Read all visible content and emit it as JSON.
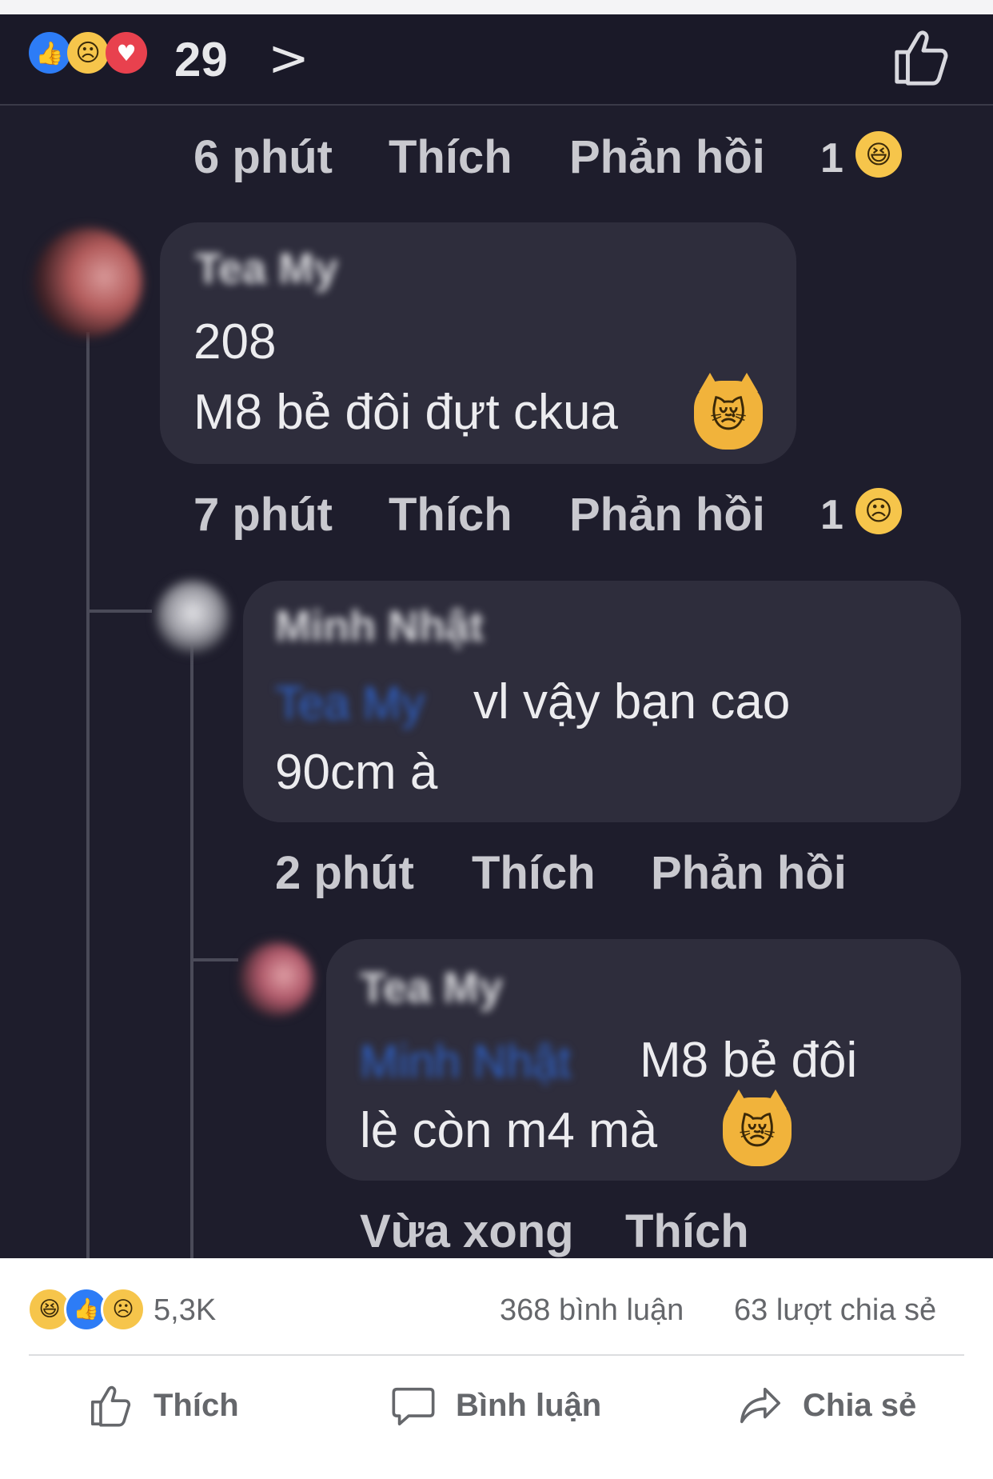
{
  "reactions_top": {
    "count": "29",
    "chevron": ">"
  },
  "comment1_meta": {
    "time": "6 phút",
    "like": "Thích",
    "reply": "Phản hồi",
    "reaction_count": "1"
  },
  "comment2": {
    "author": "Tea My",
    "line1": "208",
    "line2": "M8 bẻ đôi đựt ckua",
    "meta": {
      "time": "7 phút",
      "like": "Thích",
      "reply": "Phản hồi",
      "reaction_count": "1"
    }
  },
  "comment3": {
    "author": "Minh Nhật",
    "mention": "Tea My",
    "line1": "vl vậy bạn cao",
    "line2": "90cm à",
    "meta": {
      "time": "2 phút",
      "like": "Thích",
      "reply": "Phản hồi"
    }
  },
  "comment4": {
    "author": "Tea My",
    "mention": "Minh Nhật",
    "line1": "M8 bẻ đôi",
    "line2": "lè còn m4 mà",
    "meta": {
      "time": "Vừa xong",
      "like": "Thích"
    }
  },
  "post_summary": {
    "reaction_count": "5,3K",
    "comments": "368 bình luận",
    "shares": "63 lượt chia sẻ"
  },
  "actions": {
    "like": "Thích",
    "comment": "Bình luận",
    "share": "Chia sẻ"
  },
  "colors": {
    "dark_bg": "#1e1d2c",
    "bubble": "#2e2d3c",
    "fb_blue": "#2d7cf6",
    "text_gray": "#65676b"
  }
}
